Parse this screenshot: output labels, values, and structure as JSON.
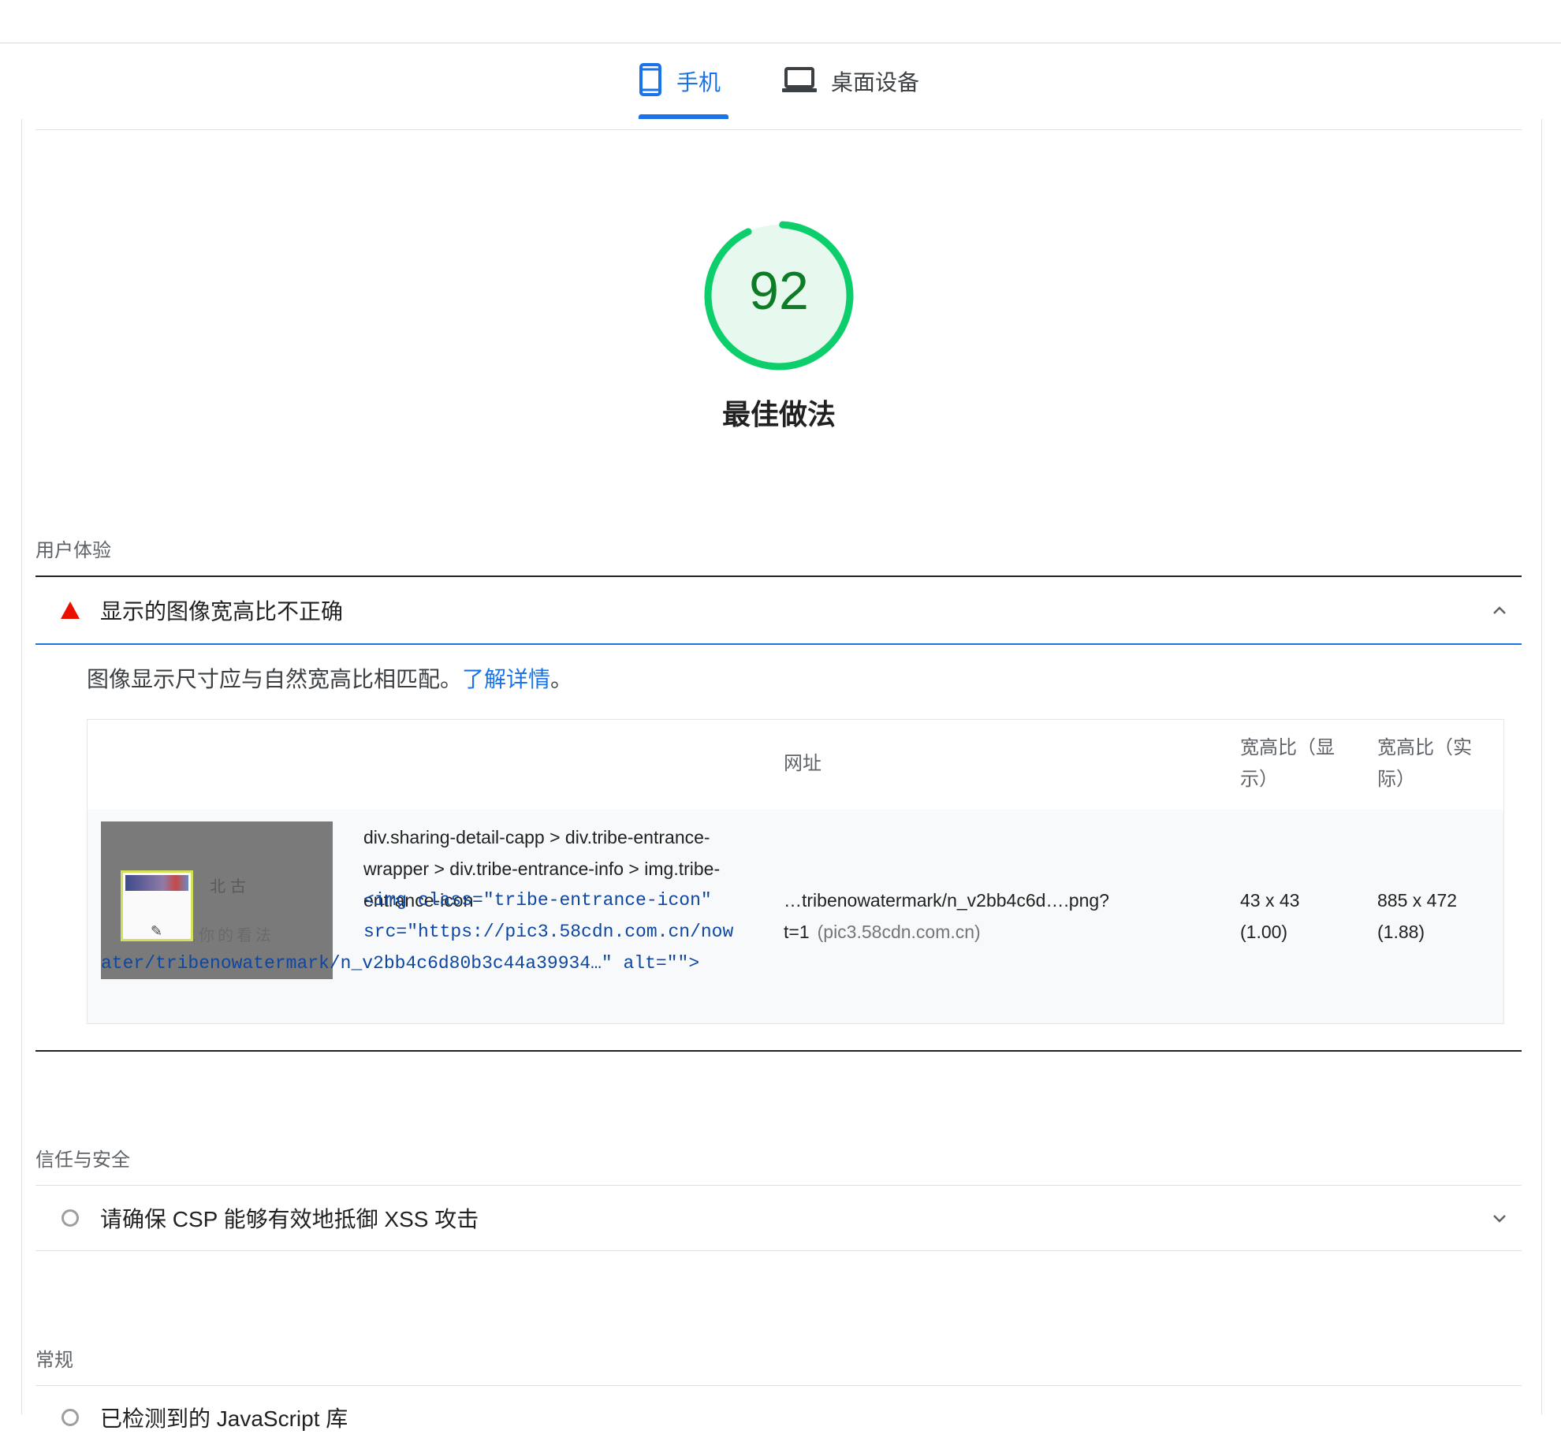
{
  "tabs": {
    "mobile_label": "手机",
    "desktop_label": "桌面设备",
    "active": "mobile"
  },
  "score": {
    "value": "92",
    "fraction": 0.92,
    "title": "最佳做法",
    "color": "#0cce6b"
  },
  "groups": {
    "ux": {
      "title": "用户体验",
      "audit": {
        "status": "fail",
        "title": "显示的图像宽高比不正确",
        "description": "图像显示尺寸应与自然宽高比相匹配。",
        "learn_more": "了解详情",
        "description_end": "。",
        "table": {
          "headers": {
            "url": "网址",
            "displayed_line1": "宽高比（显",
            "displayed_line2": "示）",
            "actual_line1": "宽高比（实",
            "actual_line2": "际）"
          },
          "row": {
            "thumb_ghost_text1": "北古",
            "thumb_ghost_text2": "说你的看法",
            "selector_line1": "div.sharing-detail-capp > div.tribe-entrance-",
            "selector_line2": "wrapper > div.tribe-entrance-info > img.tribe-",
            "selector_line3": "entrance-icon",
            "snippet_line1": "<img class=\"tribe-entrance-icon\"",
            "snippet_line2": "src=\"https://pic3.58cdn.com.cn/now",
            "snippet_line3": "ater/tribenowatermark/n_v2bb4c6d80b3c44a39934…\" alt=\"\">",
            "url_line1": "…tribenowatermark/n_v2bb4c6d….png?",
            "url_line2": "t=1",
            "url_origin": "(pic3.58cdn.com.cn)",
            "displayed_line1": "43 x 43",
            "displayed_line2": "(1.00)",
            "actual_line1": "885 x 472",
            "actual_line2": "(1.88)"
          }
        }
      }
    },
    "trust": {
      "title": "信任与安全",
      "audit": {
        "status": "info",
        "title": "请确保 CSP 能够有效地抵御 XSS 攻击"
      }
    },
    "general": {
      "title": "常规",
      "audit": {
        "status": "info",
        "title": "已检测到的 JavaScript 库"
      }
    }
  }
}
